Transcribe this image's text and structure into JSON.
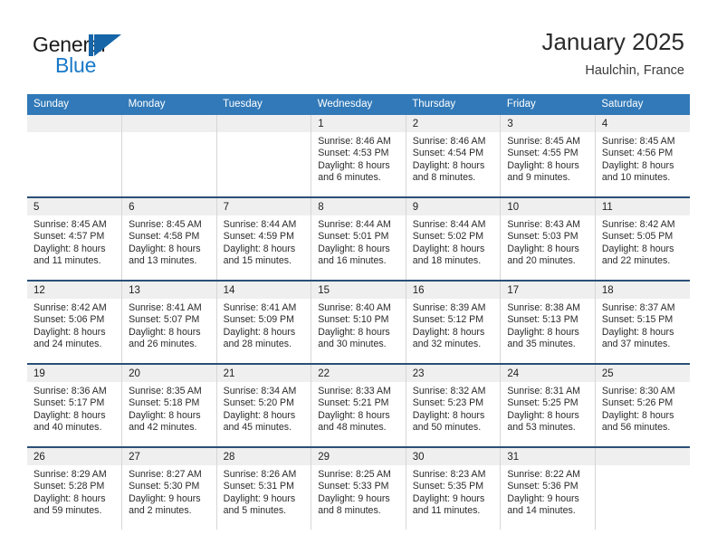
{
  "brand": {
    "name_part1": "General",
    "name_part2": "Blue",
    "mark_icon": "triangle-flag-icon",
    "accent_color": "#1878c8"
  },
  "header": {
    "title": "January 2025",
    "location": "Haulchin, France"
  },
  "calendar": {
    "header_bg": "#3179b8",
    "row_divider_color": "#2b4f77",
    "daynum_band_color": "#efefef",
    "weekdays": [
      "Sunday",
      "Monday",
      "Tuesday",
      "Wednesday",
      "Thursday",
      "Friday",
      "Saturday"
    ],
    "labels": {
      "sunrise": "Sunrise:",
      "sunset": "Sunset:",
      "daylight": "Daylight:"
    },
    "weeks": [
      [
        {
          "day": "",
          "blank": true
        },
        {
          "day": "",
          "blank": true
        },
        {
          "day": "",
          "blank": true
        },
        {
          "day": "1",
          "sunrise": "Sunrise: 8:46 AM",
          "sunset": "Sunset: 4:53 PM",
          "daylight_line1": "Daylight: 8 hours",
          "daylight_line2": "and 6 minutes."
        },
        {
          "day": "2",
          "sunrise": "Sunrise: 8:46 AM",
          "sunset": "Sunset: 4:54 PM",
          "daylight_line1": "Daylight: 8 hours",
          "daylight_line2": "and 8 minutes."
        },
        {
          "day": "3",
          "sunrise": "Sunrise: 8:45 AM",
          "sunset": "Sunset: 4:55 PM",
          "daylight_line1": "Daylight: 8 hours",
          "daylight_line2": "and 9 minutes."
        },
        {
          "day": "4",
          "sunrise": "Sunrise: 8:45 AM",
          "sunset": "Sunset: 4:56 PM",
          "daylight_line1": "Daylight: 8 hours",
          "daylight_line2": "and 10 minutes."
        }
      ],
      [
        {
          "day": "5",
          "sunrise": "Sunrise: 8:45 AM",
          "sunset": "Sunset: 4:57 PM",
          "daylight_line1": "Daylight: 8 hours",
          "daylight_line2": "and 11 minutes."
        },
        {
          "day": "6",
          "sunrise": "Sunrise: 8:45 AM",
          "sunset": "Sunset: 4:58 PM",
          "daylight_line1": "Daylight: 8 hours",
          "daylight_line2": "and 13 minutes."
        },
        {
          "day": "7",
          "sunrise": "Sunrise: 8:44 AM",
          "sunset": "Sunset: 4:59 PM",
          "daylight_line1": "Daylight: 8 hours",
          "daylight_line2": "and 15 minutes."
        },
        {
          "day": "8",
          "sunrise": "Sunrise: 8:44 AM",
          "sunset": "Sunset: 5:01 PM",
          "daylight_line1": "Daylight: 8 hours",
          "daylight_line2": "and 16 minutes."
        },
        {
          "day": "9",
          "sunrise": "Sunrise: 8:44 AM",
          "sunset": "Sunset: 5:02 PM",
          "daylight_line1": "Daylight: 8 hours",
          "daylight_line2": "and 18 minutes."
        },
        {
          "day": "10",
          "sunrise": "Sunrise: 8:43 AM",
          "sunset": "Sunset: 5:03 PM",
          "daylight_line1": "Daylight: 8 hours",
          "daylight_line2": "and 20 minutes."
        },
        {
          "day": "11",
          "sunrise": "Sunrise: 8:42 AM",
          "sunset": "Sunset: 5:05 PM",
          "daylight_line1": "Daylight: 8 hours",
          "daylight_line2": "and 22 minutes."
        }
      ],
      [
        {
          "day": "12",
          "sunrise": "Sunrise: 8:42 AM",
          "sunset": "Sunset: 5:06 PM",
          "daylight_line1": "Daylight: 8 hours",
          "daylight_line2": "and 24 minutes."
        },
        {
          "day": "13",
          "sunrise": "Sunrise: 8:41 AM",
          "sunset": "Sunset: 5:07 PM",
          "daylight_line1": "Daylight: 8 hours",
          "daylight_line2": "and 26 minutes."
        },
        {
          "day": "14",
          "sunrise": "Sunrise: 8:41 AM",
          "sunset": "Sunset: 5:09 PM",
          "daylight_line1": "Daylight: 8 hours",
          "daylight_line2": "and 28 minutes."
        },
        {
          "day": "15",
          "sunrise": "Sunrise: 8:40 AM",
          "sunset": "Sunset: 5:10 PM",
          "daylight_line1": "Daylight: 8 hours",
          "daylight_line2": "and 30 minutes."
        },
        {
          "day": "16",
          "sunrise": "Sunrise: 8:39 AM",
          "sunset": "Sunset: 5:12 PM",
          "daylight_line1": "Daylight: 8 hours",
          "daylight_line2": "and 32 minutes."
        },
        {
          "day": "17",
          "sunrise": "Sunrise: 8:38 AM",
          "sunset": "Sunset: 5:13 PM",
          "daylight_line1": "Daylight: 8 hours",
          "daylight_line2": "and 35 minutes."
        },
        {
          "day": "18",
          "sunrise": "Sunrise: 8:37 AM",
          "sunset": "Sunset: 5:15 PM",
          "daylight_line1": "Daylight: 8 hours",
          "daylight_line2": "and 37 minutes."
        }
      ],
      [
        {
          "day": "19",
          "sunrise": "Sunrise: 8:36 AM",
          "sunset": "Sunset: 5:17 PM",
          "daylight_line1": "Daylight: 8 hours",
          "daylight_line2": "and 40 minutes."
        },
        {
          "day": "20",
          "sunrise": "Sunrise: 8:35 AM",
          "sunset": "Sunset: 5:18 PM",
          "daylight_line1": "Daylight: 8 hours",
          "daylight_line2": "and 42 minutes."
        },
        {
          "day": "21",
          "sunrise": "Sunrise: 8:34 AM",
          "sunset": "Sunset: 5:20 PM",
          "daylight_line1": "Daylight: 8 hours",
          "daylight_line2": "and 45 minutes."
        },
        {
          "day": "22",
          "sunrise": "Sunrise: 8:33 AM",
          "sunset": "Sunset: 5:21 PM",
          "daylight_line1": "Daylight: 8 hours",
          "daylight_line2": "and 48 minutes."
        },
        {
          "day": "23",
          "sunrise": "Sunrise: 8:32 AM",
          "sunset": "Sunset: 5:23 PM",
          "daylight_line1": "Daylight: 8 hours",
          "daylight_line2": "and 50 minutes."
        },
        {
          "day": "24",
          "sunrise": "Sunrise: 8:31 AM",
          "sunset": "Sunset: 5:25 PM",
          "daylight_line1": "Daylight: 8 hours",
          "daylight_line2": "and 53 minutes."
        },
        {
          "day": "25",
          "sunrise": "Sunrise: 8:30 AM",
          "sunset": "Sunset: 5:26 PM",
          "daylight_line1": "Daylight: 8 hours",
          "daylight_line2": "and 56 minutes."
        }
      ],
      [
        {
          "day": "26",
          "sunrise": "Sunrise: 8:29 AM",
          "sunset": "Sunset: 5:28 PM",
          "daylight_line1": "Daylight: 8 hours",
          "daylight_line2": "and 59 minutes."
        },
        {
          "day": "27",
          "sunrise": "Sunrise: 8:27 AM",
          "sunset": "Sunset: 5:30 PM",
          "daylight_line1": "Daylight: 9 hours",
          "daylight_line2": "and 2 minutes."
        },
        {
          "day": "28",
          "sunrise": "Sunrise: 8:26 AM",
          "sunset": "Sunset: 5:31 PM",
          "daylight_line1": "Daylight: 9 hours",
          "daylight_line2": "and 5 minutes."
        },
        {
          "day": "29",
          "sunrise": "Sunrise: 8:25 AM",
          "sunset": "Sunset: 5:33 PM",
          "daylight_line1": "Daylight: 9 hours",
          "daylight_line2": "and 8 minutes."
        },
        {
          "day": "30",
          "sunrise": "Sunrise: 8:23 AM",
          "sunset": "Sunset: 5:35 PM",
          "daylight_line1": "Daylight: 9 hours",
          "daylight_line2": "and 11 minutes."
        },
        {
          "day": "31",
          "sunrise": "Sunrise: 8:22 AM",
          "sunset": "Sunset: 5:36 PM",
          "daylight_line1": "Daylight: 9 hours",
          "daylight_line2": "and 14 minutes."
        },
        {
          "day": "",
          "blank": true
        }
      ]
    ]
  }
}
